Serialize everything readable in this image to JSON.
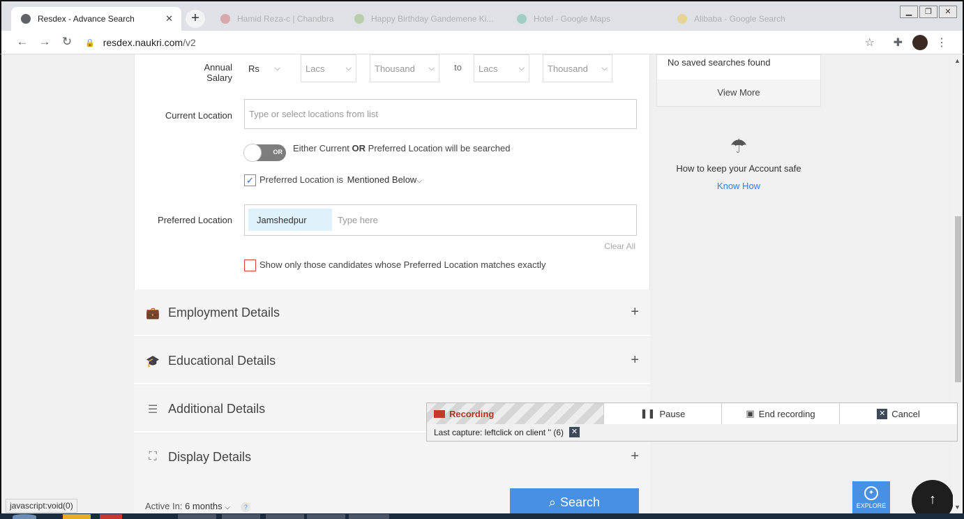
{
  "browser": {
    "active_tab_title": "Resdex - Advance Search",
    "background_tabs": [
      "Hamid Reza-c | Chandbra Sab...",
      "Happy Birthday Gandemene Ki...",
      "Hotel - Google Maps",
      "Alibaba - Google Search"
    ],
    "url_host": "resdex.naukri.com",
    "url_path": "/v2",
    "new_tab_symbol": "+",
    "close_symbol": "✕"
  },
  "salary": {
    "label": "Annual Salary",
    "currency": "Rs",
    "min_lacs": "Lacs",
    "min_thousand": "Thousand",
    "to": "to",
    "max_lacs": "Lacs",
    "max_thousand": "Thousand"
  },
  "current_location": {
    "label": "Current Location",
    "placeholder": "Type or select locations from list"
  },
  "or_toggle": {
    "toggle_text": "OR",
    "text_before": "Either Current ",
    "text_bold": "OR",
    "text_after": " Preferred Location will be searched"
  },
  "preferred_mention": {
    "checked": true,
    "label": "Preferred Location is",
    "dropdown": "Mentioned Below"
  },
  "preferred_location": {
    "label": "Preferred Location",
    "chip": "Jamshedpur",
    "placeholder": "Type here",
    "clear_all": "Clear All"
  },
  "exact_match": {
    "checked": false,
    "label": "Show only those candidates whose Preferred Location matches exactly"
  },
  "sections": [
    {
      "title": "Employment Details",
      "icon": "briefcase-icon"
    },
    {
      "title": "Educational Details",
      "icon": "graduation-cap-icon"
    },
    {
      "title": "Additional Details",
      "icon": "list-icon"
    },
    {
      "title": "Display Details",
      "icon": "display-frame-icon"
    }
  ],
  "footer": {
    "active_in_label": "Active In:",
    "active_in_value": "6 months",
    "help": "?",
    "search_button": "Search"
  },
  "side": {
    "no_saved": "No saved searches found",
    "view_more": "View More",
    "safe_title": "How to keep your Account safe",
    "know_how": "Know How"
  },
  "explore_label": "EXPLORE",
  "recording": {
    "status": "Recording",
    "pause": "Pause",
    "end": "End recording",
    "cancel": "Cancel",
    "last_capture": "Last capture: leftclick on client '' (6)"
  },
  "status_bar": "javascript:void(0)",
  "colors": {
    "accent": "#4a90e2",
    "link": "#3c7fd6",
    "recording_red": "#b23524",
    "chip_bg": "#dff2fb"
  }
}
